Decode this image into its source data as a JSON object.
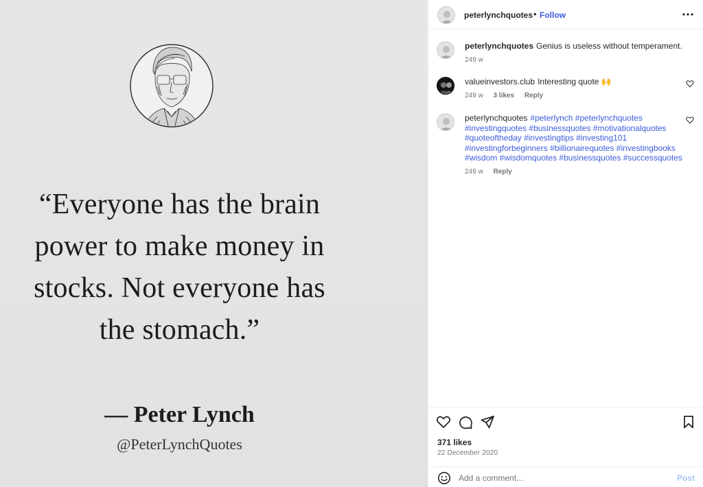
{
  "post": {
    "quote_lines": [
      "“Everyone has the brain",
      "power to make money in",
      "stocks. Not everyone has",
      "the stomach.”"
    ],
    "author": "— Peter Lynch",
    "handle": "@PeterLynchQuotes"
  },
  "header": {
    "username": "peterlynchquotes",
    "separator": "•",
    "follow_label": "Follow",
    "more_icon": "more-horizontal-icon"
  },
  "comments": [
    {
      "username": "peterlynchquotes",
      "text": "Genius is useless without temperament.",
      "time": "249 w"
    },
    {
      "username": "valueinvestors.club",
      "text": "Interesting quote 🙌",
      "time": "249 w",
      "likes": "3 likes",
      "reply": "Reply"
    },
    {
      "username": "peterlynchquotes",
      "hashtags": "#peterlynch #peterlynchquotes #investingquotes #businessquotes #motivationalquotes #quoteoftheday #investingtips #investing101 #investingforbeginners #billionairequotes #investingbooks #wisdom #wisdomquotes #businessquotes #successquotes",
      "time": "249 w",
      "reply": "Reply"
    }
  ],
  "actions": {
    "likes": "371 likes",
    "date": "22 December 2020",
    "icons": [
      "heart-icon",
      "comment-icon",
      "share-icon",
      "bookmark-icon"
    ]
  },
  "add_comment": {
    "placeholder": "Add a comment...",
    "post_label": "Post",
    "emoji_icon": "smiley-icon"
  },
  "colors": {
    "link": "#3b5bdb",
    "text": "#262626",
    "muted": "#737373",
    "image_bg": "#e4e4e4"
  }
}
